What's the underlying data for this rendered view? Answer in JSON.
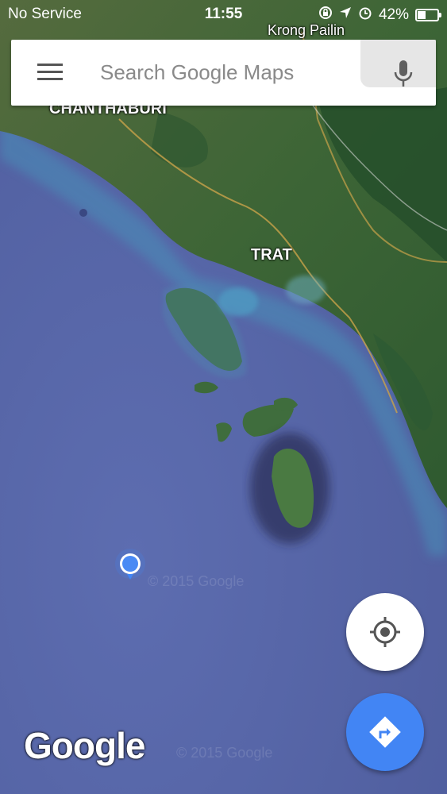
{
  "status_bar": {
    "carrier": "No Service",
    "time": "11:55",
    "battery_percent": "42%",
    "battery_level": 0.42,
    "icons": [
      "lock-rotation-icon",
      "location-arrow-icon",
      "alarm-icon",
      "battery-icon"
    ]
  },
  "search": {
    "placeholder": "Search Google Maps",
    "value": ""
  },
  "map_labels": {
    "region_top": "Krong Pailin",
    "province_1": "CHANTHABURI",
    "province_2": "TRAT"
  },
  "watermark": "© 2015 Google",
  "logo_text": "Google",
  "buttons": {
    "my_location": "my-location-icon",
    "directions": "directions-icon"
  },
  "colors": {
    "sea": "#5a6aaa",
    "land": "#3f6a3c",
    "accent_blue": "#4285f4"
  }
}
